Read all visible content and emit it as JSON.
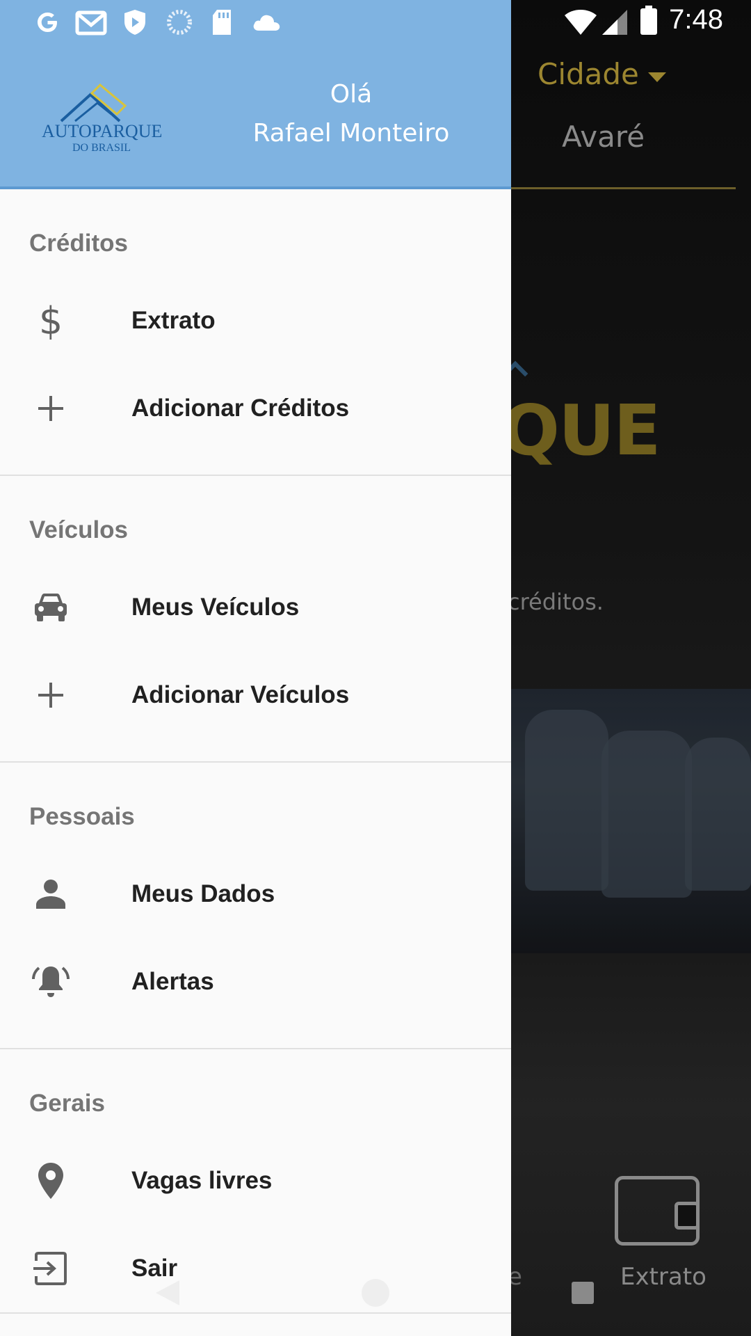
{
  "status_bar": {
    "time": "7:48",
    "notification_icons": [
      "google-icon",
      "gmail-icon",
      "shield-play-icon",
      "sync-icon",
      "sd-card-icon",
      "cloud-icon"
    ],
    "system_icons": [
      "wifi-icon",
      "signal-icon",
      "battery-icon"
    ]
  },
  "drawer": {
    "header": {
      "logo_text": "AUTOPARQUE",
      "logo_subtext": "DO BRASIL",
      "greeting": "Olá",
      "user_name": "Rafael Monteiro"
    },
    "sections": [
      {
        "title": "Créditos",
        "items": [
          {
            "label": "Extrato",
            "icon": "dollar-icon"
          },
          {
            "label": "Adicionar Créditos",
            "icon": "plus-icon"
          }
        ]
      },
      {
        "title": "Veículos",
        "items": [
          {
            "label": "Meus Veículos",
            "icon": "car-icon"
          },
          {
            "label": "Adicionar Veículos",
            "icon": "plus-icon"
          }
        ]
      },
      {
        "title": "Pessoais",
        "items": [
          {
            "label": "Meus Dados",
            "icon": "person-icon"
          },
          {
            "label": "Alertas",
            "icon": "bell-ring-icon"
          }
        ]
      },
      {
        "title": "Gerais",
        "items": [
          {
            "label": "Vagas livres",
            "icon": "location-pin-icon"
          },
          {
            "label": "Sair",
            "icon": "exit-icon"
          }
        ]
      }
    ]
  },
  "background": {
    "city_label": "Cidade",
    "city_value": "Avaré",
    "logo_fragment": "QUE",
    "hint_fragment": "créditos.",
    "nav_left_fragment": "e",
    "nav_extrato_label": "Extrato"
  },
  "colors": {
    "drawer_header": "#7fb3e1",
    "accent_gold": "#9c8630",
    "drawer_bg": "#fafafa"
  }
}
